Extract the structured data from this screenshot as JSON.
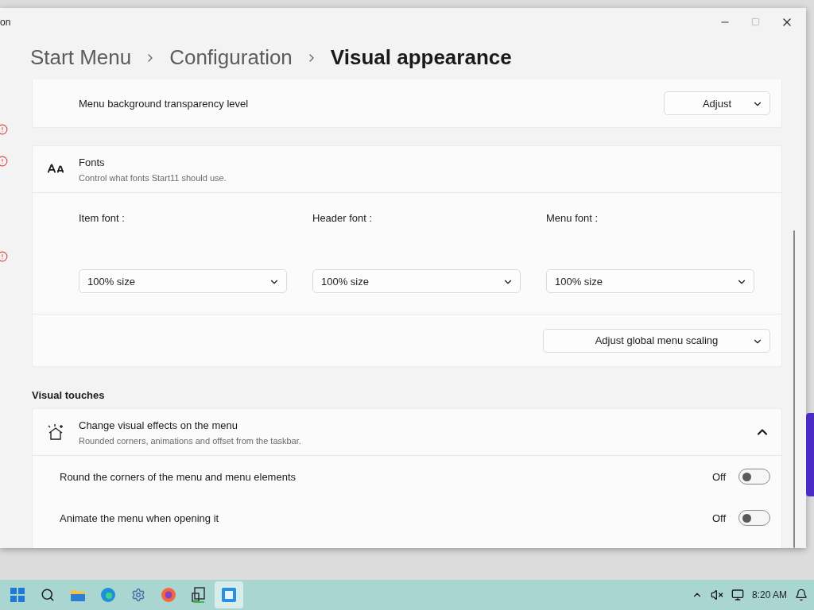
{
  "window": {
    "title_fragment": "on"
  },
  "breadcrumb": [
    {
      "label": "Start Menu",
      "current": false
    },
    {
      "label": "Configuration",
      "current": false
    },
    {
      "label": "Visual appearance",
      "current": true
    }
  ],
  "transparency": {
    "label": "Menu background transparency level",
    "dropdown": "Adjust"
  },
  "fonts": {
    "title": "Fonts",
    "description": "Control what fonts Start11 should use.",
    "pickers": [
      {
        "label": "Item font :",
        "value": "100% size"
      },
      {
        "label": "Header font :",
        "value": "100% size"
      },
      {
        "label": "Menu font :",
        "value": "100% size"
      }
    ],
    "scaling": "Adjust global menu scaling"
  },
  "section_heading": "Visual touches",
  "effects": {
    "title": "Change visual effects on the menu",
    "description": "Rounded corners, animations and offset from the taskbar.",
    "expanded": true,
    "options": [
      {
        "label": "Round the corners of the menu and menu elements",
        "state_text": "Off",
        "on": false
      },
      {
        "label": "Animate the menu when opening it",
        "state_text": "Off",
        "on": false
      }
    ]
  },
  "taskbar": {
    "apps": [
      {
        "kind": "start",
        "selected": false
      },
      {
        "kind": "search",
        "selected": false
      },
      {
        "kind": "files",
        "selected": false
      },
      {
        "kind": "browser",
        "selected": false
      },
      {
        "kind": "settings",
        "selected": false
      },
      {
        "kind": "firefox",
        "selected": false
      },
      {
        "kind": "tool",
        "selected": false
      },
      {
        "kind": "start11",
        "selected": true
      }
    ],
    "time": "8:20 AM"
  }
}
